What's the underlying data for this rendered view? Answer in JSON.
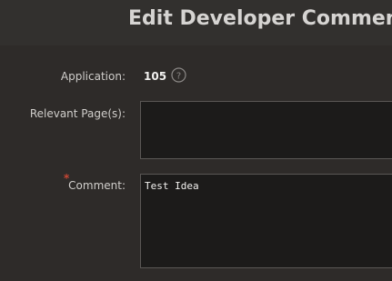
{
  "header": {
    "title": "Edit Developer Comment"
  },
  "form": {
    "application": {
      "label": "Application:",
      "value": "105",
      "help_icon": "question-circle-icon"
    },
    "relevant_pages": {
      "label": "Relevant Page(s):",
      "value": ""
    },
    "comment": {
      "label": "Comment:",
      "required_marker": "*",
      "value": "Test Idea"
    }
  },
  "colors": {
    "background": "#2e2b29",
    "header_background": "#32302e",
    "input_background": "#1c1b1a",
    "required": "#c74634",
    "text": "#d0cecb"
  }
}
